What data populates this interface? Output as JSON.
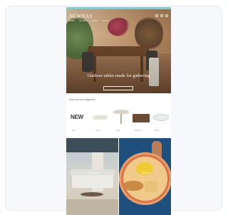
{
  "hero": {
    "brand": "NEWNAS",
    "nav": [
      "SHOP",
      "ROOMS",
      "ABOUT",
      "SALE"
    ],
    "headline": "Outdoor tables made for gathering"
  },
  "categories": {
    "title": "Shop our new categories",
    "new_label": "NEW",
    "labels": [
      "New",
      "Sofa",
      "Lamp",
      "Benches",
      "Bowls"
    ]
  },
  "tiles": [
    {
      "caption": "Living room"
    },
    {
      "caption": "Tableware"
    }
  ],
  "colors": {
    "top_bar": "#8fc9c2",
    "card_bg": "#f6f8fc"
  }
}
